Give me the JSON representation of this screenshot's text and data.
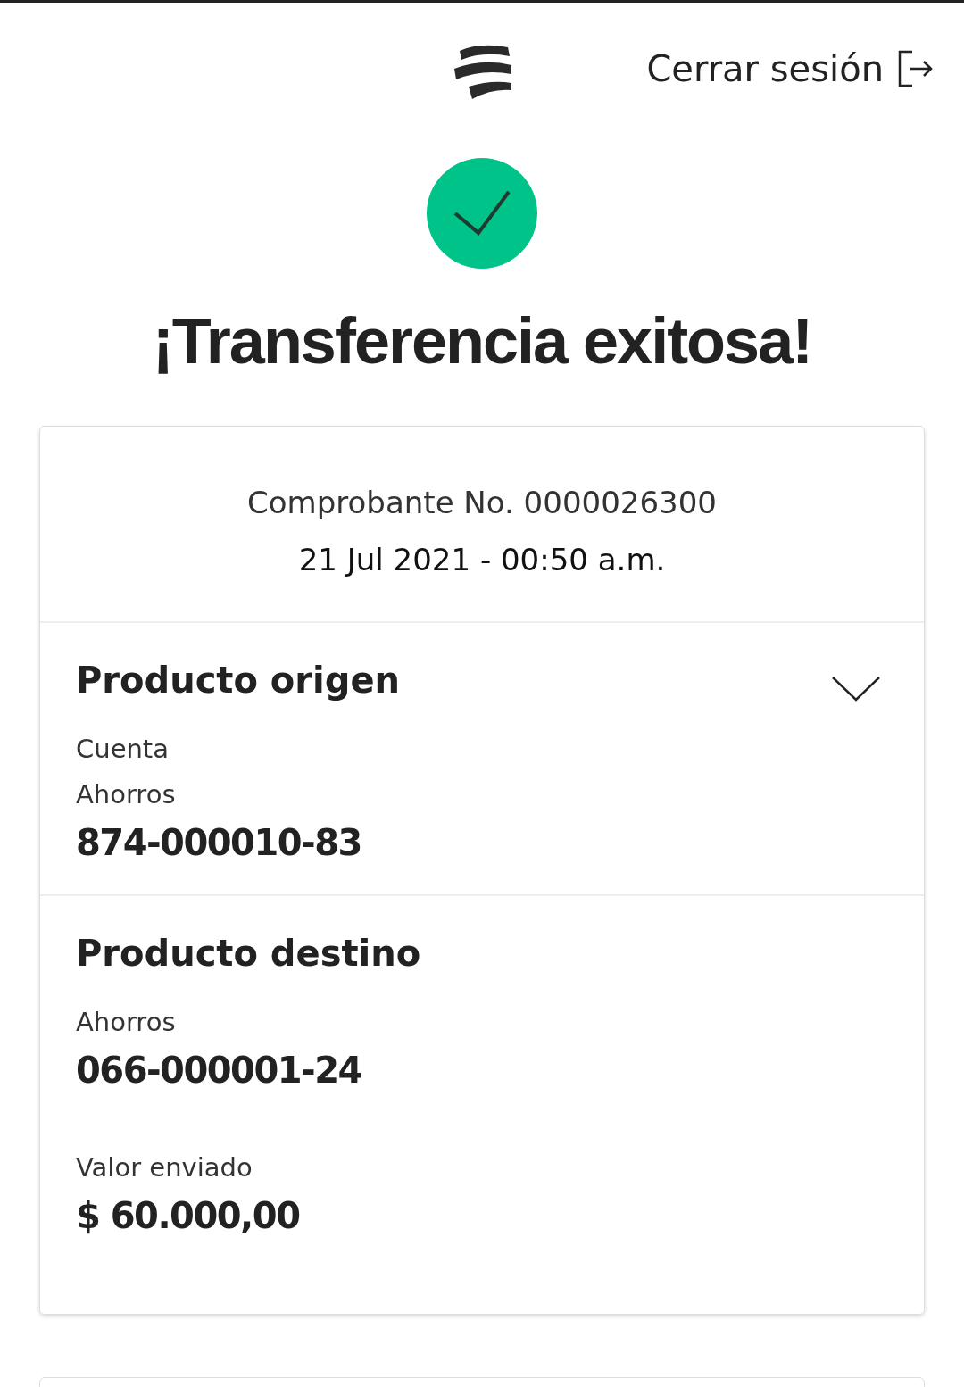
{
  "header": {
    "logout_label": "Cerrar sesión"
  },
  "title": "¡Transferencia exitosa!",
  "receipt": {
    "number": "Comprobante No. 0000026300",
    "datetime": "21 Jul 2021 - 00:50 a.m."
  },
  "sections": [
    {
      "title": "Producto origen",
      "collapsible": true,
      "items": [
        {
          "kind": "label",
          "text": "Cuenta"
        },
        {
          "kind": "label",
          "text": "Ahorros"
        },
        {
          "kind": "value",
          "text": "874-000010-83"
        }
      ]
    },
    {
      "title": "Producto destino",
      "collapsible": false,
      "items": [
        {
          "kind": "label",
          "text": "Ahorros"
        },
        {
          "kind": "value",
          "text": "066-000001-24"
        },
        {
          "kind": "gap"
        },
        {
          "kind": "label",
          "text": "Valor enviado"
        },
        {
          "kind": "value",
          "text": "$ 60.000,00"
        }
      ]
    }
  ]
}
